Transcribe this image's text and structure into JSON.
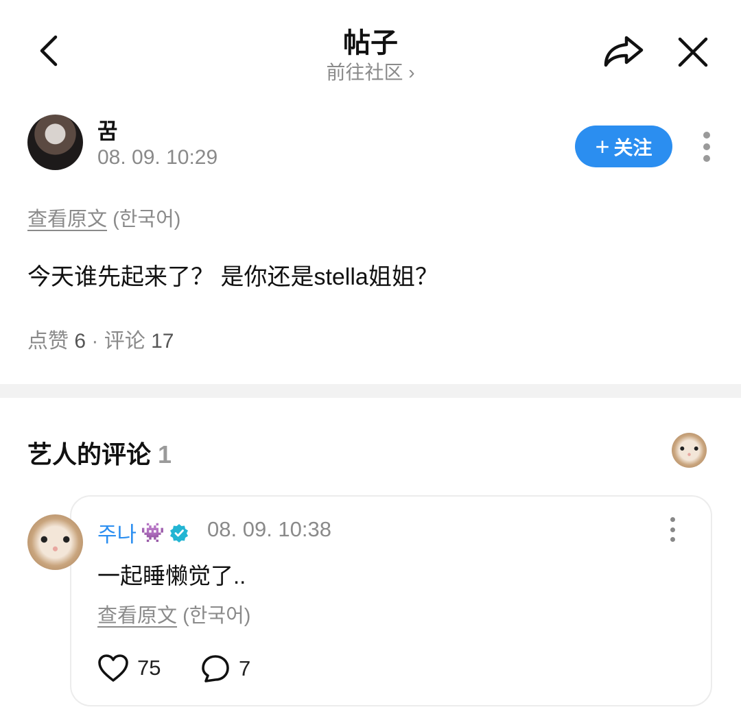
{
  "header": {
    "title": "帖子",
    "subtitle": "前往社区",
    "subtitle_chevron": "›"
  },
  "icons": {
    "back": "chevron-left-icon",
    "share": "share-arrow-icon",
    "close": "close-icon",
    "more": "more-vertical-icon",
    "verified": "verified-badge-icon",
    "like": "heart-icon",
    "comment": "comment-bubble-icon"
  },
  "colors": {
    "accent": "#2b8ef0",
    "muted_text": "#8a8a8a",
    "divider": "#f2f2f2"
  },
  "post": {
    "author": "꿈",
    "time": "08. 09. 10:29",
    "follow_label": "关注",
    "follow_plus": "+",
    "translate_link": "查看原文",
    "translate_lang": "(한국어)",
    "body": "今天谁先起来了？ 是你还是stella姐姐？",
    "likes_label": "点赞",
    "likes_count": "6",
    "separator": "·",
    "comments_label": "评论",
    "comments_count": "17"
  },
  "artist_comments": {
    "title": "艺人的评论",
    "count": "1"
  },
  "comment": {
    "author": "주나",
    "author_emoji": "👾",
    "time": "08. 09. 10:38",
    "body": "一起睡懒觉了..",
    "translate_link": "查看原文",
    "translate_lang": "(한국어)",
    "like_count": "75",
    "reply_count": "7"
  }
}
